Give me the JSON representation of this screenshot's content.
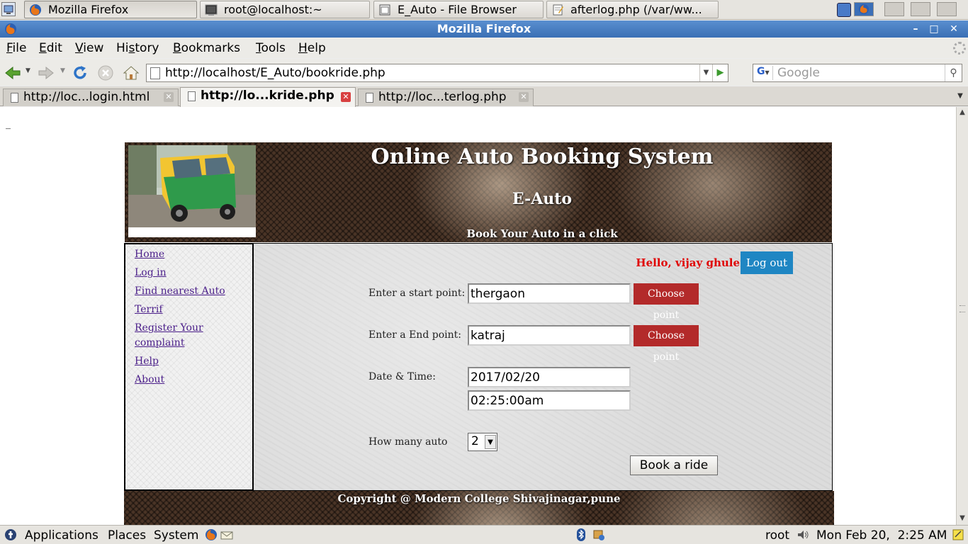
{
  "taskbar": {
    "buttons": [
      {
        "label": "Mozilla Firefox"
      },
      {
        "label": "root@localhost:~"
      },
      {
        "label": "E_Auto - File Browser"
      },
      {
        "label": "afterlog.php (/var/ww..."
      }
    ]
  },
  "window": {
    "title": "Mozilla Firefox"
  },
  "menubar": {
    "items": [
      {
        "accel": "F",
        "rest": "ile"
      },
      {
        "accel": "E",
        "rest": "dit"
      },
      {
        "accel": "V",
        "rest": "iew"
      },
      {
        "pre": "Hi",
        "accel": "s",
        "rest": "tory"
      },
      {
        "accel": "B",
        "rest": "ookmarks"
      },
      {
        "accel": "T",
        "rest": "ools"
      },
      {
        "accel": "H",
        "rest": "elp"
      }
    ]
  },
  "navbar": {
    "url": "http://localhost/E_Auto/bookride.php",
    "search_placeholder": "Google",
    "search_engine": "G"
  },
  "tabs": [
    {
      "label": "http://loc...login.html"
    },
    {
      "label": "http://lo...kride.php"
    },
    {
      "label": "http://loc...terlog.php"
    }
  ],
  "page": {
    "stray_text": "_",
    "header": {
      "title": "Online Auto Booking System",
      "subtitle": "E-Auto",
      "tagline": "Book Your Auto in a click"
    },
    "sidebar": {
      "links": [
        {
          "label": "Home"
        },
        {
          "label": "Log in"
        },
        {
          "label": "Find nearest Auto"
        },
        {
          "label": "Terrif"
        },
        {
          "label": "Register Your complaint"
        },
        {
          "label": "Help"
        },
        {
          "label": "About"
        }
      ]
    },
    "greeting": "Hello, vijay ghule",
    "logout_label": "Log out",
    "form": {
      "start_label": "Enter a start point:",
      "start_value": "thergaon",
      "end_label": "Enter a End point:",
      "end_value": "katraj",
      "choose_label": "Choose point",
      "datetime_label": "Date & Time:",
      "date_value": "2017/02/20",
      "time_value": "02:25:00am",
      "count_label": "How many auto",
      "count_value": "2",
      "submit_label": "Book a ride"
    },
    "footer": "Copyright @ Modern College Shivajinagar,pune"
  },
  "bottom_panel": {
    "applications": "Applications",
    "places": "Places",
    "system": "System",
    "user": "root",
    "clock": "Mon Feb 20,  2:25 AM"
  },
  "colors": {
    "greeting": "#e00000",
    "logout_bg": "#1f86c3",
    "choose_bg": "#b32a2a",
    "link": "#4b1f8a",
    "titlebar": "#3a6fb4"
  }
}
